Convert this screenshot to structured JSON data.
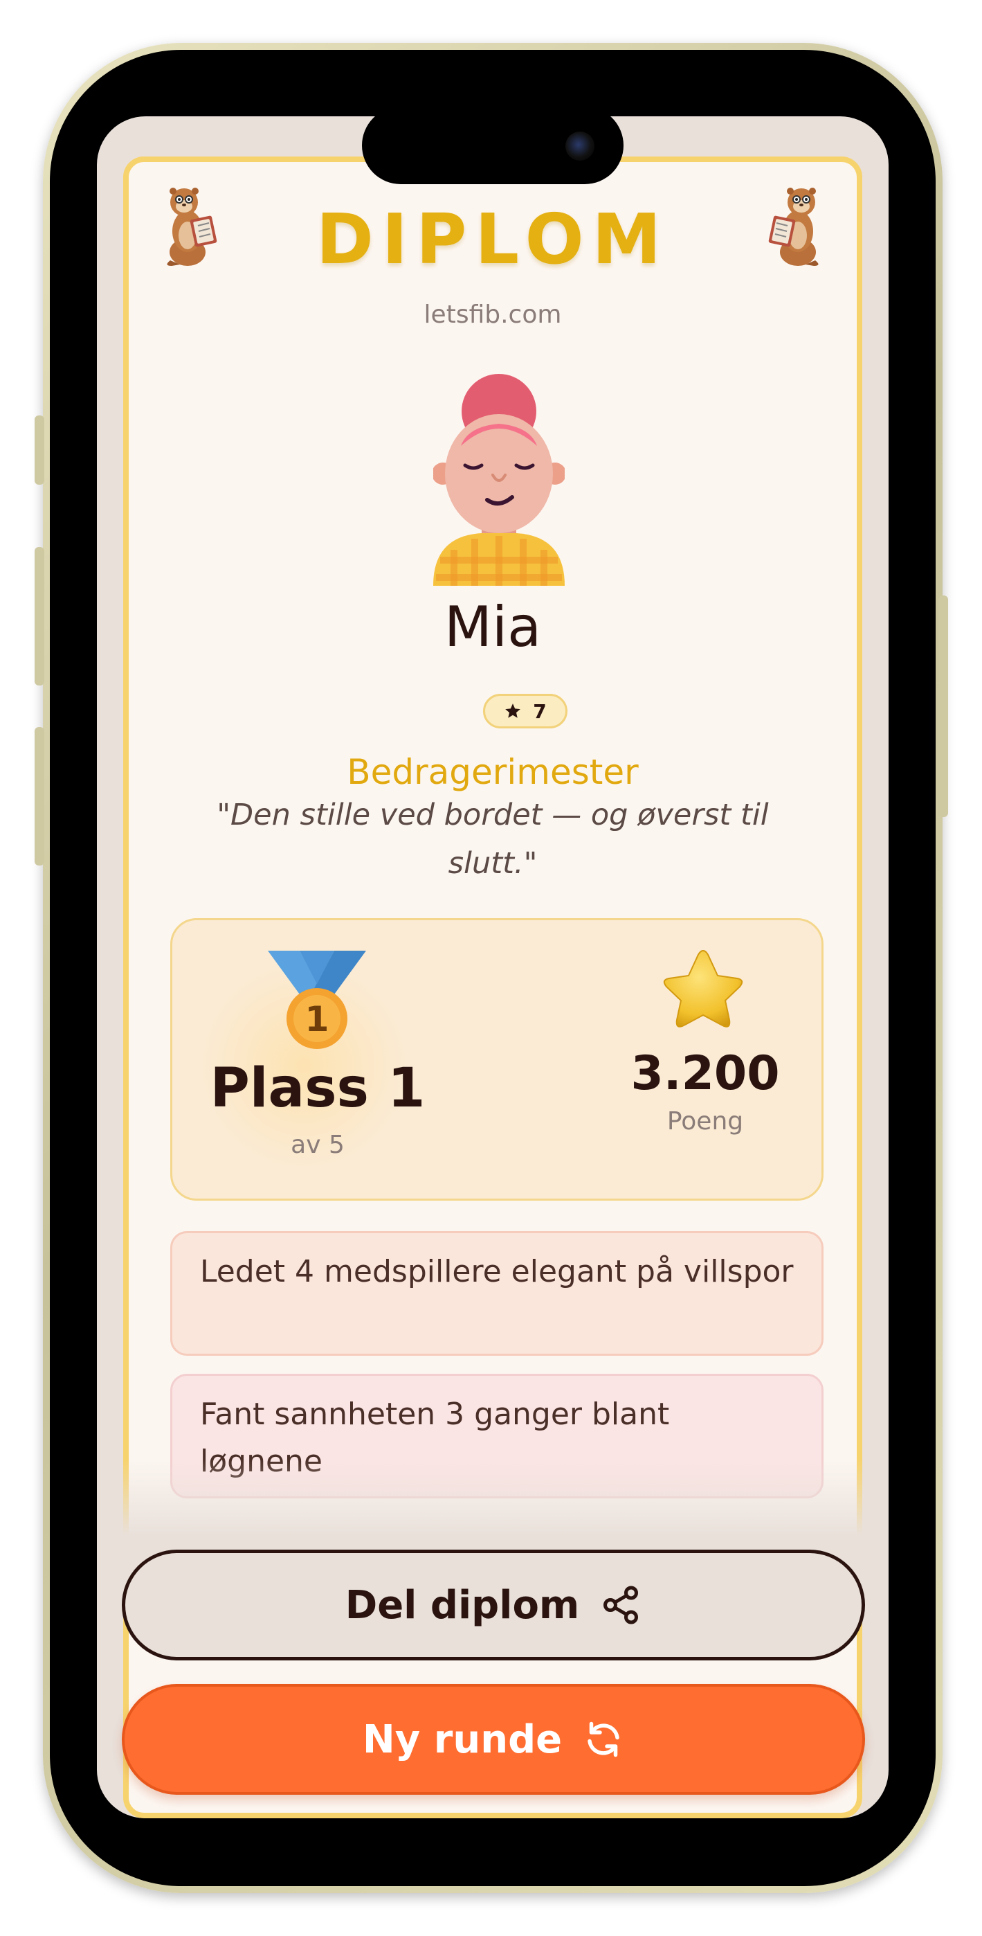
{
  "diploma": {
    "title": "DIPLOM",
    "site": "letsfib.com"
  },
  "player": {
    "name": "Mia",
    "level": "7",
    "rank_title": "Bedragerimester",
    "quote": "\"Den stille ved bordet — og øverst til slutt.\""
  },
  "stats": {
    "place_label": "Plass 1",
    "place_of": "av 5",
    "medal_number": "1",
    "points_value": "3.200",
    "points_label": "Poeng"
  },
  "achievements": [
    {
      "text": "Ledet 4 medspillere elegant på villspor"
    },
    {
      "text": "Fant sannheten 3 ganger blant løgnene"
    }
  ],
  "actions": {
    "share_label": "Del diplom",
    "new_round_label": "Ny runde"
  },
  "colors": {
    "title_gold": "#e5b012",
    "card_border": "#f7d36e",
    "primary_orange": "#ff6d30",
    "text_dark": "#2b1410"
  },
  "icons": [
    "otter-mascot-icon",
    "avatar-icon",
    "star-icon",
    "medal-icon",
    "share-icon",
    "refresh-icon"
  ]
}
